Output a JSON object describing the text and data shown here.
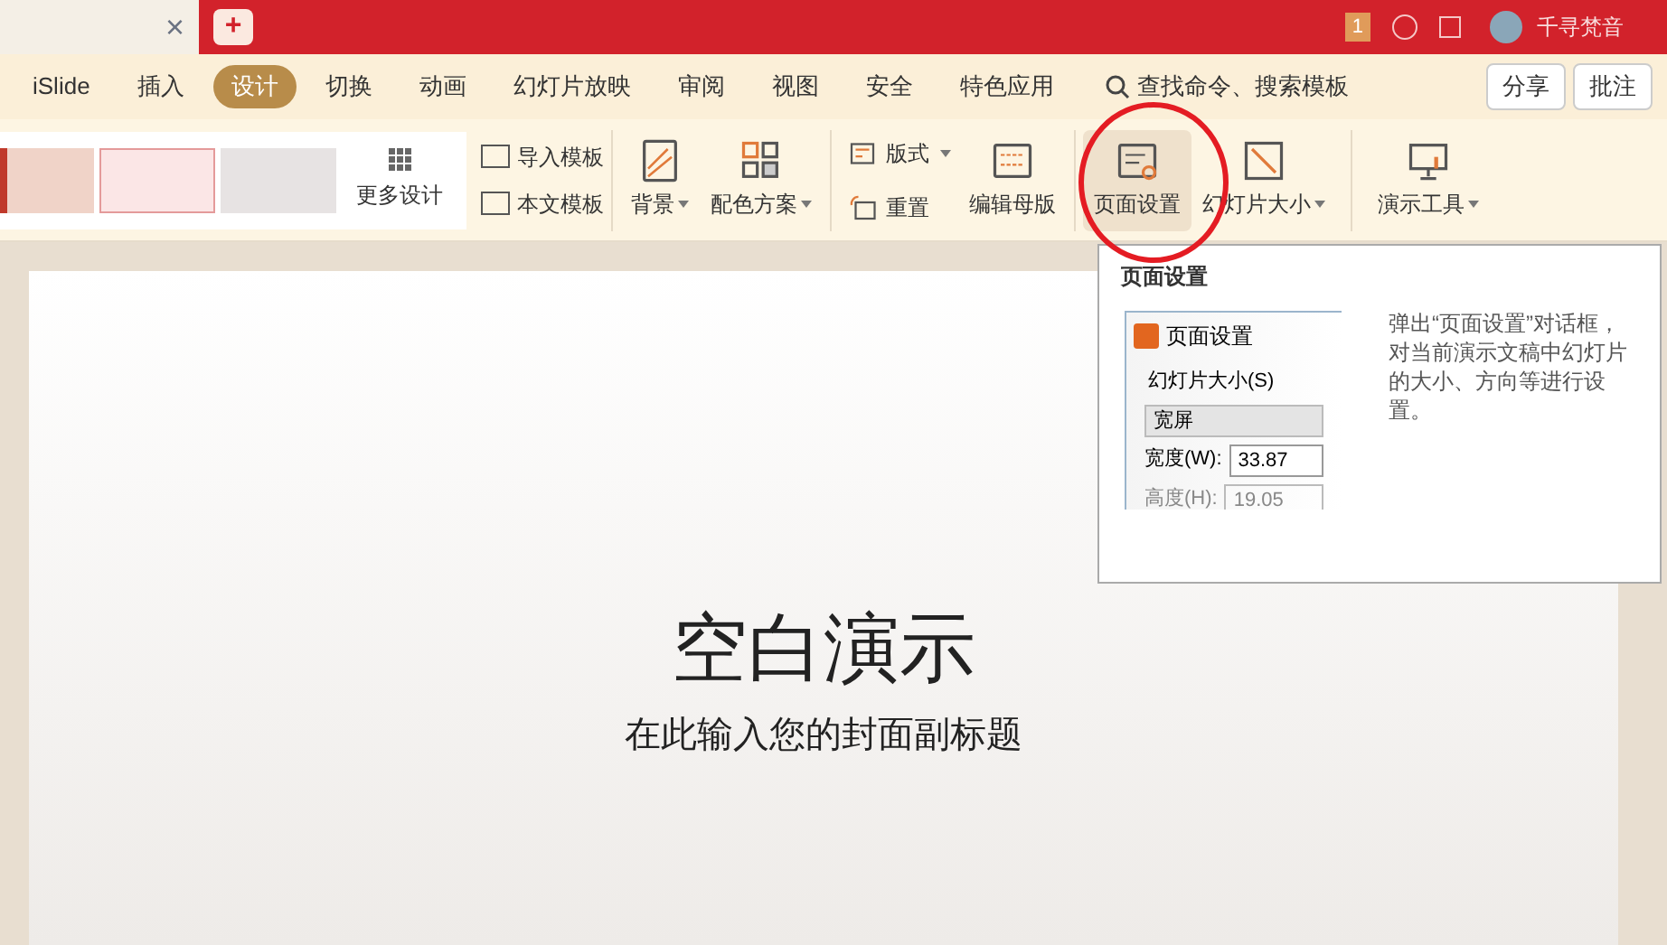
{
  "titlebar": {
    "close": "×",
    "new_tab": "+",
    "badge": "1",
    "user": "千寻梵音"
  },
  "menu": [
    {
      "label": "iSlide",
      "selected": false
    },
    {
      "label": "插入",
      "selected": false
    },
    {
      "label": "设计",
      "selected": true
    },
    {
      "label": "切换",
      "selected": false
    },
    {
      "label": "动画",
      "selected": false
    },
    {
      "label": "幻灯片放映",
      "selected": false
    },
    {
      "label": "审阅",
      "selected": false
    },
    {
      "label": "视图",
      "selected": false
    },
    {
      "label": "安全",
      "selected": false
    },
    {
      "label": "特色应用",
      "selected": false
    }
  ],
  "search": {
    "placeholder": "查找命令、搜索模板"
  },
  "actions": [
    "分享",
    "批注"
  ],
  "ribbon": {
    "more": "更多设计",
    "template_import": "导入模板",
    "template_body": "本文模板",
    "tools": [
      {
        "label": "背景",
        "kind": "large",
        "dropdown": true,
        "selected": false
      },
      {
        "label": "配色方案",
        "kind": "large",
        "dropdown": true,
        "selected": false
      },
      {
        "label": "版式",
        "kind": "small",
        "dropdown": true,
        "selected": false
      },
      {
        "label": "重置",
        "kind": "small",
        "dropdown": false,
        "selected": false
      },
      {
        "label": "编辑母版",
        "kind": "large",
        "dropdown": false,
        "selected": false
      },
      {
        "label": "页面设置",
        "kind": "large",
        "dropdown": false,
        "selected": true
      },
      {
        "label": "幻灯片大小",
        "kind": "large",
        "dropdown": true,
        "selected": false
      },
      {
        "label": "演示工具",
        "kind": "large",
        "dropdown": true,
        "selected": false
      }
    ]
  },
  "tooltip": {
    "title": "页面设置",
    "preview_title": "页面设置",
    "group": "幻灯片大小(S)",
    "select": "宽屏",
    "width_label": "宽度(W):",
    "width_value": "33.87",
    "height_label": "高度(H):",
    "height_value": "19.05",
    "description": "弹出“页面设置”对话框，对当前演示文稿中幻灯片的大小、方向等进行设置。"
  },
  "slide": {
    "title": "空白演示",
    "subtitle": "在此输入您的封面副标题"
  }
}
